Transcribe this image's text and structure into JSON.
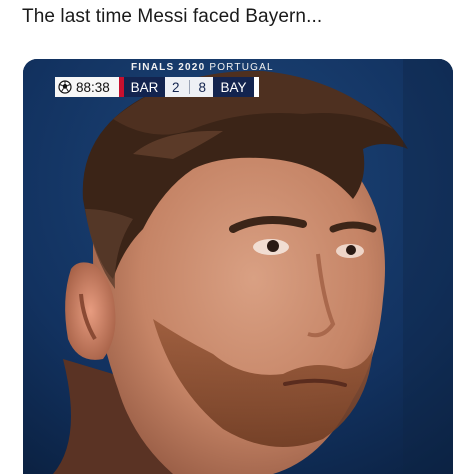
{
  "caption": "The last time Messi faced Bayern...",
  "broadcast": {
    "competition_bold": "FINALS 2020",
    "competition_light": "PORTUGAL",
    "clock_icon": "champions-league-ball-icon",
    "clock": "88:38",
    "home_team": "BAR",
    "home_score": "2",
    "away_score": "8",
    "away_team": "BAY",
    "colors": {
      "home_accent": "#c8102e",
      "bar_background": "#13244f"
    }
  }
}
